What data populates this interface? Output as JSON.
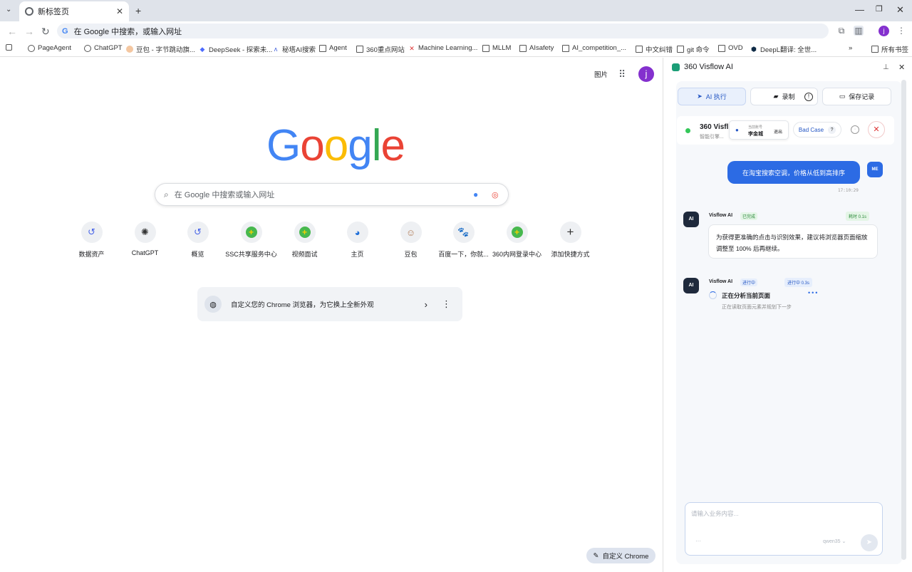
{
  "tab": {
    "title": "新标签页"
  },
  "address": {
    "placeholder": "在 Google 中搜索，或输入网址"
  },
  "bookmarks": [
    "PageAgent",
    "ChatGPT",
    "豆包 - 字节跳动旗...",
    "DeepSeek - 探索未...",
    "秘塔AI搜索",
    "Agent",
    "360重点网站",
    "Machine Learning...",
    "MLLM",
    "AIsafety",
    "AI_competition_...",
    "中文纠错",
    "git 命令",
    "OVD",
    "DeepL翻译: 全世...",
    "所有书签"
  ],
  "google": {
    "images_link": "图片",
    "avatar": "j",
    "search_placeholder": "在 Google 中搜索或输入网址"
  },
  "shortcuts": [
    "数据资产",
    "ChatGPT",
    "概览",
    "SSC共享服务中心",
    "视频面试",
    "主页",
    "豆包",
    "百度一下，你就...",
    "360内网登录中心",
    "添加快捷方式"
  ],
  "customize_card": {
    "text": "自定义您的 Chrome 浏览器，为它换上全新外观"
  },
  "customize_button": "自定义 Chrome",
  "panel": {
    "title": "360 Visflow AI",
    "tabs": [
      "AI 执行",
      "录制",
      "保存记录"
    ],
    "status": {
      "name": "360 Visfl",
      "sub": "智能引擎...",
      "account_label": "当前账号",
      "account_name": "李金城",
      "logout": "退出",
      "badcase": "Bad Case"
    },
    "user_msg": {
      "text": "在淘宝搜索空调，价格从低到高排序",
      "time": "17:10:29",
      "avatar": "ME"
    },
    "ai_msg1": {
      "sender": "Visflow AI",
      "tag": "已完成",
      "timer": "耗时 0.1s",
      "text": "为获得更准确的点击与识别效果，建议将浏览器页面缩放调整至 100% 后再继续。"
    },
    "ai_msg2": {
      "sender": "Visflow AI",
      "tag": "进行中",
      "timer": "进行中 0.3s",
      "title": "正在分析当前页面",
      "sub": "正在读取页面元素并规划下一步"
    },
    "ai_avatar": "AI",
    "composer": {
      "placeholder": "请输入业务内容...",
      "model": "qwen35",
      "more": "···"
    }
  }
}
